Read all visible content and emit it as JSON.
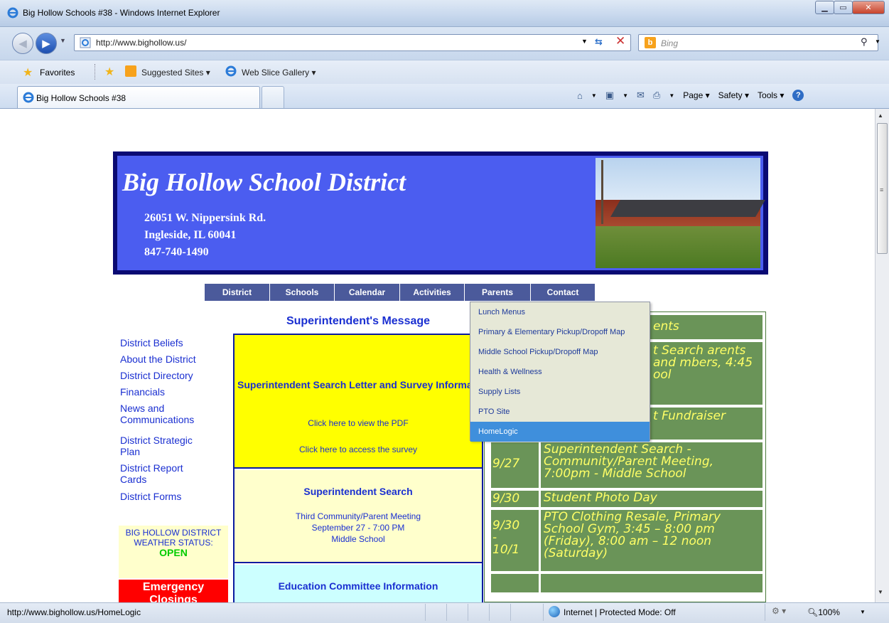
{
  "window": {
    "title": "Big Hollow Schools #38 - Windows Internet Explorer"
  },
  "nav": {
    "url": "http://www.bighollow.us/",
    "search_placeholder": "Bing"
  },
  "favorites": {
    "label": "Favorites",
    "suggested": "Suggested Sites ▾",
    "webslice": "Web Slice Gallery ▾"
  },
  "tab": {
    "label": "Big Hollow Schools #38"
  },
  "command_bar": {
    "page": "Page",
    "safety": "Safety",
    "tools": "Tools"
  },
  "status": {
    "url": "http://www.bighollow.us/HomeLogic",
    "zone": "Internet | Protected Mode: Off",
    "zoom": "100%"
  },
  "site": {
    "title": "Big Hollow School District",
    "address1": "26051 W. Nippersink Rd.",
    "address2": "Ingleside, IL 60041",
    "phone": "847-740-1490"
  },
  "menu": [
    "District",
    "Schools",
    "Calendar",
    "Activities",
    "Parents",
    "Contact"
  ],
  "dropdown": [
    "Lunch Menus",
    "Primary & Elementary Pickup/Dropoff Map",
    "Middle School Pickup/Dropoff Map",
    "Health & Wellness",
    "Supply Lists",
    "PTO Site",
    "HomeLogic"
  ],
  "sidebar": {
    "links": [
      "District Beliefs",
      "About the District",
      "District Directory",
      "Financials",
      "News and Communications",
      "District Strategic Plan",
      "District Report Cards",
      "District Forms"
    ],
    "weather_label": "BIG HOLLOW DISTRICT WEATHER STATUS:",
    "weather_status": "OPEN",
    "emergency": "Emergency Closings"
  },
  "message": {
    "heading": "Superintendent's Message",
    "card1_title": "Superintendent Search Letter and Survey Information",
    "card1_link1": "Click here to view the PDF",
    "card1_link2": "Click here to access the survey",
    "card2_title": "Superintendent Search",
    "card2_line1": "Third Community/Parent Meeting",
    "card2_line2": "September 27 - 7:00 PM",
    "card2_line3": "Middle School",
    "card3_title": "Education Committee Information"
  },
  "events": {
    "heading_partial": "ents",
    "row1_partial": "t Search arents and mbers, 4:45 ool",
    "row2_partial": "t Fundraiser",
    "rows": [
      {
        "date": "9/27",
        "text": "Superintendent Search - Community/Parent Meeting, 7:00pm - Middle School"
      },
      {
        "date": "9/30",
        "text": "Student Photo Day"
      },
      {
        "date": "9/30 - 10/1",
        "text": "PTO Clothing Resale, Primary School Gym, 3:45 – 8:00 pm (Friday), 8:00 am – 12 noon (Saturday)"
      }
    ]
  }
}
